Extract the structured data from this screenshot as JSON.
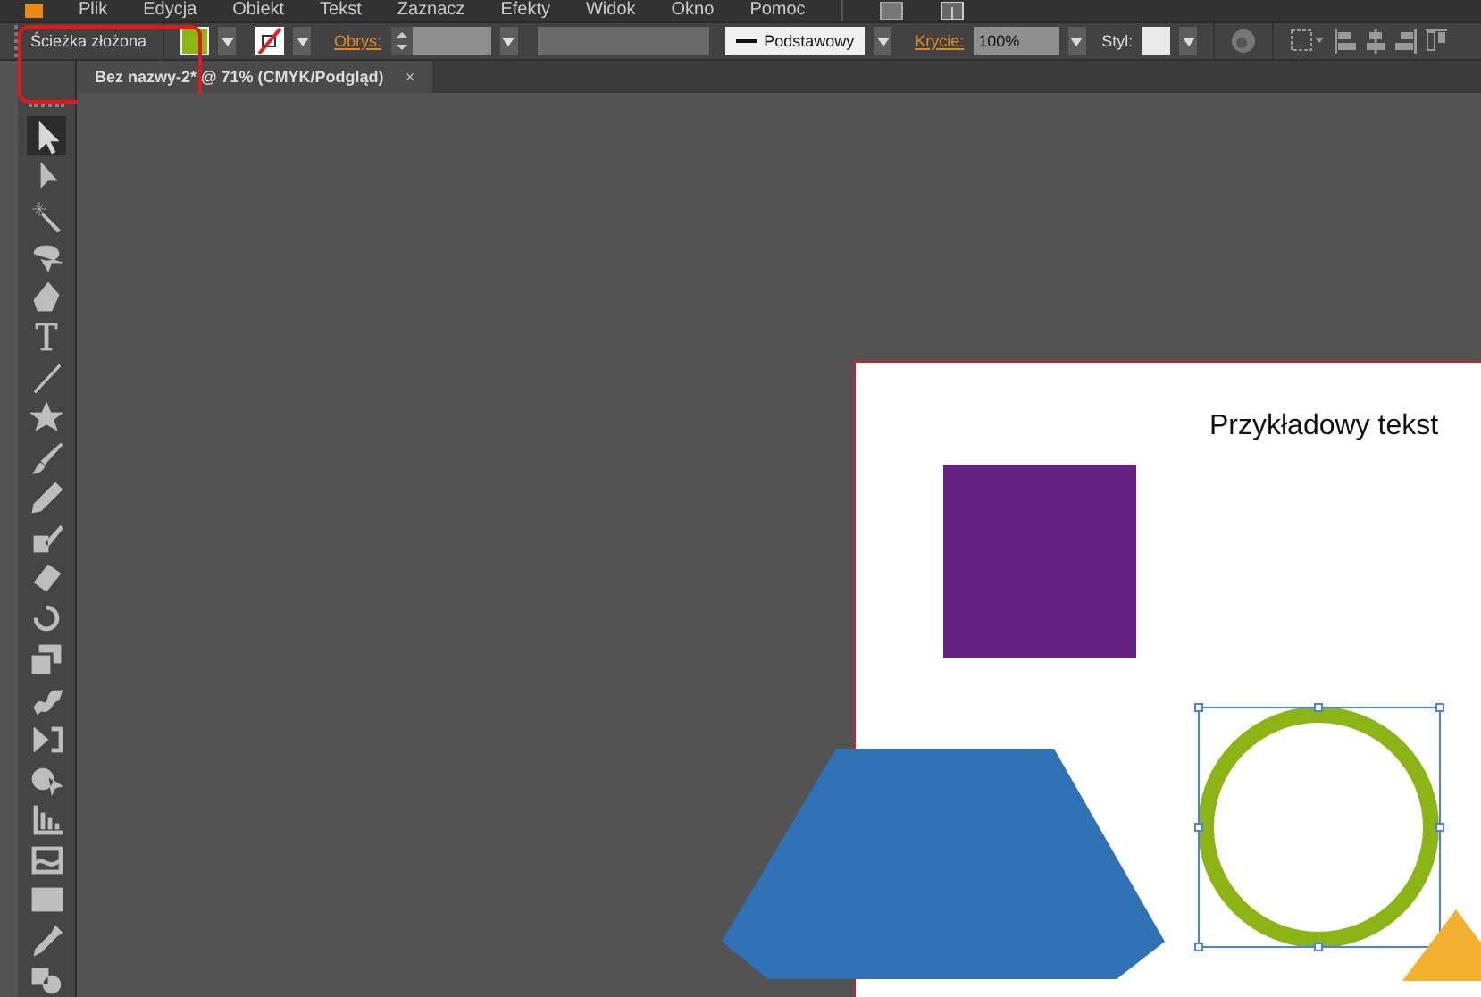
{
  "menu_bar": {
    "items": [
      "Plik",
      "Edycja",
      "Obiekt",
      "Tekst",
      "Zaznacz",
      "Efekty",
      "Widok",
      "Okno",
      "Pomoc"
    ]
  },
  "control_bar": {
    "object_type": "Ścieżka złożona",
    "stroke_label": "Obrys:",
    "brush": "Podstawowy",
    "opacity_label": "Krycie:",
    "opacity": "100%",
    "style_label": "Styl:"
  },
  "document_tab": {
    "title": "Bez nazwy-2* @ 71% (CMYK/Podgląd)",
    "close": "×"
  },
  "tools": [
    {
      "selected": true
    },
    {
      "selected": false
    },
    {
      "selected": false
    },
    {
      "selected": false
    },
    {
      "selected": false
    },
    {
      "selected": false
    },
    {
      "selected": false
    },
    {
      "selected": false
    },
    {
      "selected": false
    },
    {
      "selected": false
    },
    {
      "selected": false
    },
    {
      "selected": false
    },
    {
      "selected": false
    },
    {
      "selected": false
    },
    {
      "selected": false
    },
    {
      "selected": false
    },
    {
      "selected": false
    },
    {
      "selected": false
    },
    {
      "selected": false
    },
    {
      "selected": false
    },
    {
      "selected": false
    },
    {
      "selected": false
    }
  ],
  "artboard": {
    "text": "Przykładowy tekst"
  }
}
